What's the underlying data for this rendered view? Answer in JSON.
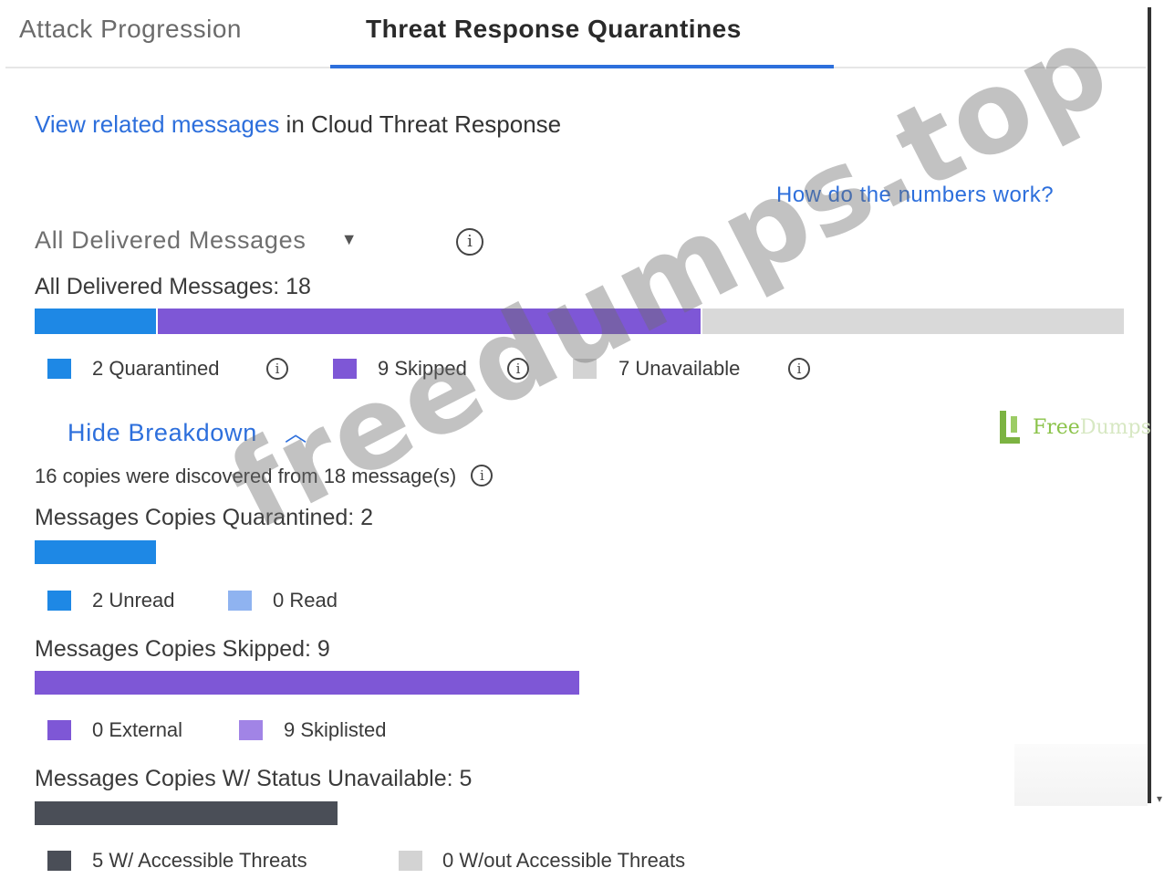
{
  "tabs": [
    {
      "label": "Attack Progression",
      "active": false
    },
    {
      "label": "Threat Response Quarantines",
      "active": true
    }
  ],
  "related": {
    "link_text": "View related messages",
    "rest_text": " in Cloud Threat Response"
  },
  "help_link": "How do the numbers work?",
  "filter": {
    "selected": "All Delivered Messages",
    "caret_icon": "caret-down-icon",
    "info_icon": "info-icon"
  },
  "summary": {
    "title": "All Delivered Messages: 18",
    "total": 18,
    "segments": [
      {
        "name": "quarantined",
        "value": 2,
        "color": "#1e88e5"
      },
      {
        "name": "skipped",
        "value": 9,
        "color": "#7e57d6"
      },
      {
        "name": "unavailable",
        "value": 7,
        "color": "#d9d9d9"
      }
    ],
    "legend": [
      {
        "label": "2 Quarantined",
        "color": "#1e88e5",
        "has_info": true
      },
      {
        "label": "9 Skipped",
        "color": "#7e57d6",
        "has_info": true
      },
      {
        "label": "7 Unavailable",
        "color": "#d3d3d3",
        "has_info": true
      }
    ]
  },
  "breakdown": {
    "toggle_label": "Hide Breakdown",
    "toggle_icon": "chevron-up-icon",
    "copies_note": "16 copies were discovered from 18 message(s)",
    "quarantined": {
      "title": "Messages Copies Quarantined: 2",
      "value": 2,
      "color": "#1e88e5",
      "legend": [
        {
          "label": "2 Unread",
          "color": "#1e88e5"
        },
        {
          "label": "0 Read",
          "color": "#8fb3f0"
        }
      ]
    },
    "skipped": {
      "title": "Messages Copies Skipped: 9",
      "value": 9,
      "color": "#7e57d6",
      "legend": [
        {
          "label": "0 External",
          "color": "#7e57d6"
        },
        {
          "label": "9 Skiplisted",
          "color": "#a184e6"
        }
      ]
    },
    "unavailable": {
      "title": "Messages Copies W/ Status Unavailable: 5",
      "value": 5,
      "color": "#4a4e57",
      "legend": [
        {
          "label": "5 W/ Accessible Threats",
          "color": "#4a4e57"
        },
        {
          "label": "0 W/out Accessible Threats",
          "color": "#d3d3d3"
        }
      ]
    }
  },
  "watermark": "freedumps.top",
  "logo": {
    "text_strong": "Free",
    "text_faint": "Dumps"
  }
}
